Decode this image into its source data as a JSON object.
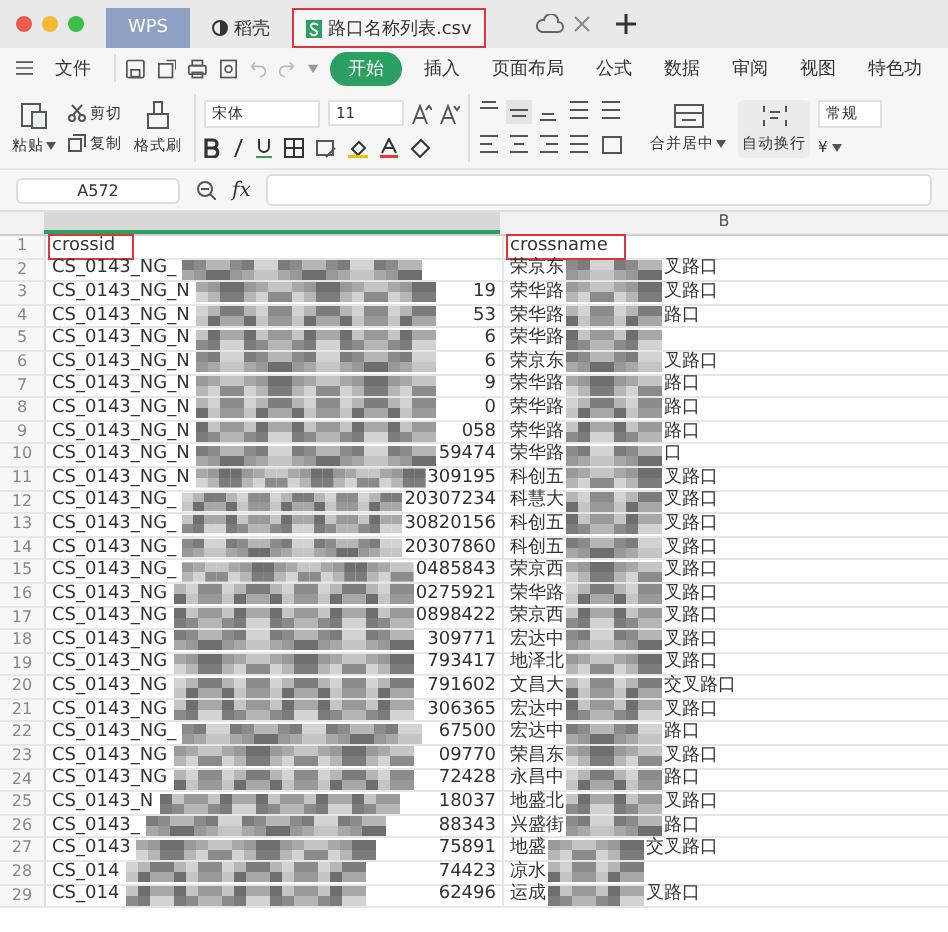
{
  "tabs": [
    {
      "label": "WPS",
      "kind": "brand",
      "selected": false,
      "highlighted": false
    },
    {
      "label": "稻壳",
      "kind": "docer",
      "selected": false,
      "highlighted": false
    },
    {
      "label": "路口名称列表.csv",
      "kind": "sheet",
      "selected": true,
      "highlighted": true
    }
  ],
  "menu": {
    "file": "文件",
    "items": [
      {
        "label": "开始",
        "selected": true
      },
      {
        "label": "插入",
        "selected": false
      },
      {
        "label": "页面布局",
        "selected": false
      },
      {
        "label": "公式",
        "selected": false
      },
      {
        "label": "数据",
        "selected": false
      },
      {
        "label": "审阅",
        "selected": false
      },
      {
        "label": "视图",
        "selected": false
      },
      {
        "label": "特色功",
        "selected": false
      }
    ]
  },
  "ribbon": {
    "paste": "粘贴",
    "cut": "剪切",
    "copy": "复制",
    "format_painter": "格式刷",
    "font": "宋体",
    "font_size": "11",
    "merge": "合并居中",
    "wrap": "自动换行",
    "number_format": "常规",
    "currency": "¥"
  },
  "formula_bar": {
    "cell_ref": "A572",
    "fx": "fx"
  },
  "columns": [
    {},
    {
      "label": "B"
    }
  ],
  "header_row": {
    "number": "1",
    "cells": [
      {
        "text": "crossid",
        "highlighted": true
      },
      {
        "text": "crossname",
        "highlighted": true
      }
    ]
  },
  "rows": [
    {
      "number": "2",
      "a": {
        "prefix": "CS_0143_NG_"
      },
      "b": {
        "prefix": "荣京东",
        "suffix": "叉路口"
      }
    },
    {
      "number": "3",
      "a": {
        "prefix": "CS_0143_NG_N",
        "suffix": "19"
      },
      "b": {
        "prefix": "荣华路",
        "suffix": "叉路口"
      }
    },
    {
      "number": "4",
      "a": {
        "prefix": "CS_0143_NG_N",
        "suffix": "53"
      },
      "b": {
        "prefix": "荣华路",
        "suffix": "路口"
      }
    },
    {
      "number": "5",
      "a": {
        "prefix": "CS_0143_NG_N",
        "suffix": "6"
      },
      "b": {
        "prefix": "荣华路"
      }
    },
    {
      "number": "6",
      "a": {
        "prefix": "CS_0143_NG_N",
        "suffix": "6"
      },
      "b": {
        "prefix": "荣京东",
        "suffix": "叉路口"
      }
    },
    {
      "number": "7",
      "a": {
        "prefix": "CS_0143_NG_N",
        "suffix": "9"
      },
      "b": {
        "prefix": "荣华路",
        "suffix": "路口"
      }
    },
    {
      "number": "8",
      "a": {
        "prefix": "CS_0143_NG_N",
        "suffix": "0"
      },
      "b": {
        "prefix": "荣华路",
        "suffix": "路口"
      }
    },
    {
      "number": "9",
      "a": {
        "prefix": "CS_0143_NG_N",
        "suffix": "058"
      },
      "b": {
        "prefix": "荣华路",
        "suffix": "路口"
      }
    },
    {
      "number": "10",
      "a": {
        "prefix": "CS_0143_NG_N",
        "suffix": "59474"
      },
      "b": {
        "prefix": "荣华路",
        "suffix": "口"
      }
    },
    {
      "number": "11",
      "a": {
        "prefix": "CS_0143_NG_N",
        "suffix": "309195"
      },
      "b": {
        "prefix": "科创五",
        "suffix": "叉路口"
      }
    },
    {
      "number": "12",
      "a": {
        "prefix": "CS_0143_NG_",
        "suffix": "20307234"
      },
      "b": {
        "prefix": "科慧大",
        "suffix": "叉路口"
      }
    },
    {
      "number": "13",
      "a": {
        "prefix": "CS_0143_NG_",
        "suffix": "30820156"
      },
      "b": {
        "prefix": "科创五",
        "suffix": "叉路口"
      }
    },
    {
      "number": "14",
      "a": {
        "prefix": "CS_0143_NG_",
        "suffix": "20307860"
      },
      "b": {
        "prefix": "科创五",
        "suffix": "叉路口"
      }
    },
    {
      "number": "15",
      "a": {
        "prefix": "CS_0143_NG_",
        "suffix": "0485843"
      },
      "b": {
        "prefix": "荣京西",
        "suffix": "叉路口"
      }
    },
    {
      "number": "16",
      "a": {
        "prefix": "CS_0143_NG",
        "suffix": "0275921"
      },
      "b": {
        "prefix": "荣华路",
        "suffix": "叉路口"
      }
    },
    {
      "number": "17",
      "a": {
        "prefix": "CS_0143_NG",
        "suffix": "0898422"
      },
      "b": {
        "prefix": "荣京西",
        "suffix": "叉路口"
      }
    },
    {
      "number": "18",
      "a": {
        "prefix": "CS_0143_NG",
        "suffix": "309771"
      },
      "b": {
        "prefix": "宏达中",
        "suffix": "叉路口"
      }
    },
    {
      "number": "19",
      "a": {
        "prefix": "CS_0143_NG",
        "suffix": "793417"
      },
      "b": {
        "prefix": "地泽北",
        "suffix": "叉路口"
      }
    },
    {
      "number": "20",
      "a": {
        "prefix": "CS_0143_NG",
        "suffix": "791602"
      },
      "b": {
        "prefix": "文昌大",
        "suffix": "交叉路口"
      }
    },
    {
      "number": "21",
      "a": {
        "prefix": "CS_0143_NG",
        "suffix": "306365"
      },
      "b": {
        "prefix": "宏达中",
        "suffix": "叉路口"
      }
    },
    {
      "number": "22",
      "a": {
        "prefix": "CS_0143_NG_",
        "suffix": "67500"
      },
      "b": {
        "prefix": "宏达中",
        "suffix": "路口"
      }
    },
    {
      "number": "23",
      "a": {
        "prefix": "CS_0143_NG",
        "suffix": "09770"
      },
      "b": {
        "prefix": "荣昌东",
        "suffix": "叉路口"
      }
    },
    {
      "number": "24",
      "a": {
        "prefix": "CS_0143_NG",
        "suffix": "72428"
      },
      "b": {
        "prefix": "永昌中",
        "suffix": "路口"
      }
    },
    {
      "number": "25",
      "a": {
        "prefix": "CS_0143_N",
        "suffix": "18037"
      },
      "b": {
        "prefix": "地盛北",
        "suffix": "叉路口"
      }
    },
    {
      "number": "26",
      "a": {
        "prefix": "CS_0143_",
        "suffix": "88343"
      },
      "b": {
        "prefix": "兴盛街",
        "suffix": "路口"
      }
    },
    {
      "number": "27",
      "a": {
        "prefix": "CS_0143",
        "suffix": "75891"
      },
      "b": {
        "prefix": "地盛",
        "suffix": "交叉路口"
      }
    },
    {
      "number": "28",
      "a": {
        "prefix": "CS_014",
        "suffix": "74423"
      },
      "b": {
        "prefix": "凉水"
      }
    },
    {
      "number": "29",
      "a": {
        "prefix": "CS_014",
        "suffix": "62496"
      },
      "b": {
        "prefix": "运成",
        "suffix": "叉路口"
      }
    }
  ]
}
